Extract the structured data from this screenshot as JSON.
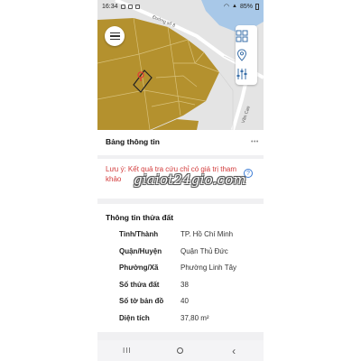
{
  "status_bar": {
    "time": "16:34",
    "battery": "85%"
  },
  "map": {
    "road_label_top": "Đường số 8",
    "road_label_right": "Văn Cao",
    "colors": {
      "land": "#b4912e",
      "parcel_lines": "#d8c17a",
      "road": "#ffffff",
      "water": "#a8c8e8",
      "selected_outline": "#222222",
      "marker": "#e53935"
    }
  },
  "panel": {
    "title": "Bảng thông tin",
    "more_icon": "more-dots-icon",
    "note": "Lưu ý: Kết quả tra cứu chỉ có giá trị tham khảo",
    "watermark": "giaiot24gio.com",
    "section_title": "Thông tin thửa đất",
    "rows": [
      {
        "label": "Tỉnh/Thành",
        "value": "TP. Hồ Chí Minh"
      },
      {
        "label": "Quận/Huyện",
        "value": "Quận Thủ Đức"
      },
      {
        "label": "Phường/Xã",
        "value": "Phường Linh Tây"
      },
      {
        "label": "Số thửa đất",
        "value": "38"
      },
      {
        "label": "Số tờ bản đồ",
        "value": "40"
      },
      {
        "label": "Diện tích",
        "value": "37,80 m²"
      }
    ]
  },
  "nav": {
    "recent": "III",
    "back": "‹"
  }
}
